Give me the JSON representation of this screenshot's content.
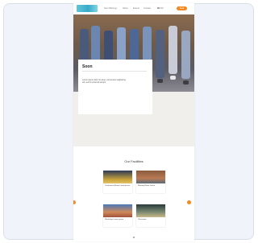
{
  "nav": {
    "links": [
      "Nos Offerings",
      "About",
      "Events",
      "Contact"
    ],
    "language": "FR",
    "cta": "Book"
  },
  "hero": {
    "card_title": "Soon",
    "card_text": "Lorem ipsum dolor sit amet, consectetur adipiscing elit, sed do eiusmod tempor"
  },
  "facilities": {
    "title": "Our Facilities",
    "items": [
      {
        "label": "Conference Room Lorem ipsum"
      },
      {
        "label": "Meeting Room Lorem"
      },
      {
        "label": "Workshop Lorem ipsum"
      },
      {
        "label": "Classroom"
      }
    ]
  },
  "colors": {
    "accent": "#f08a24",
    "logo": "#3aa9c8",
    "hero_bg": "#f1efec"
  }
}
